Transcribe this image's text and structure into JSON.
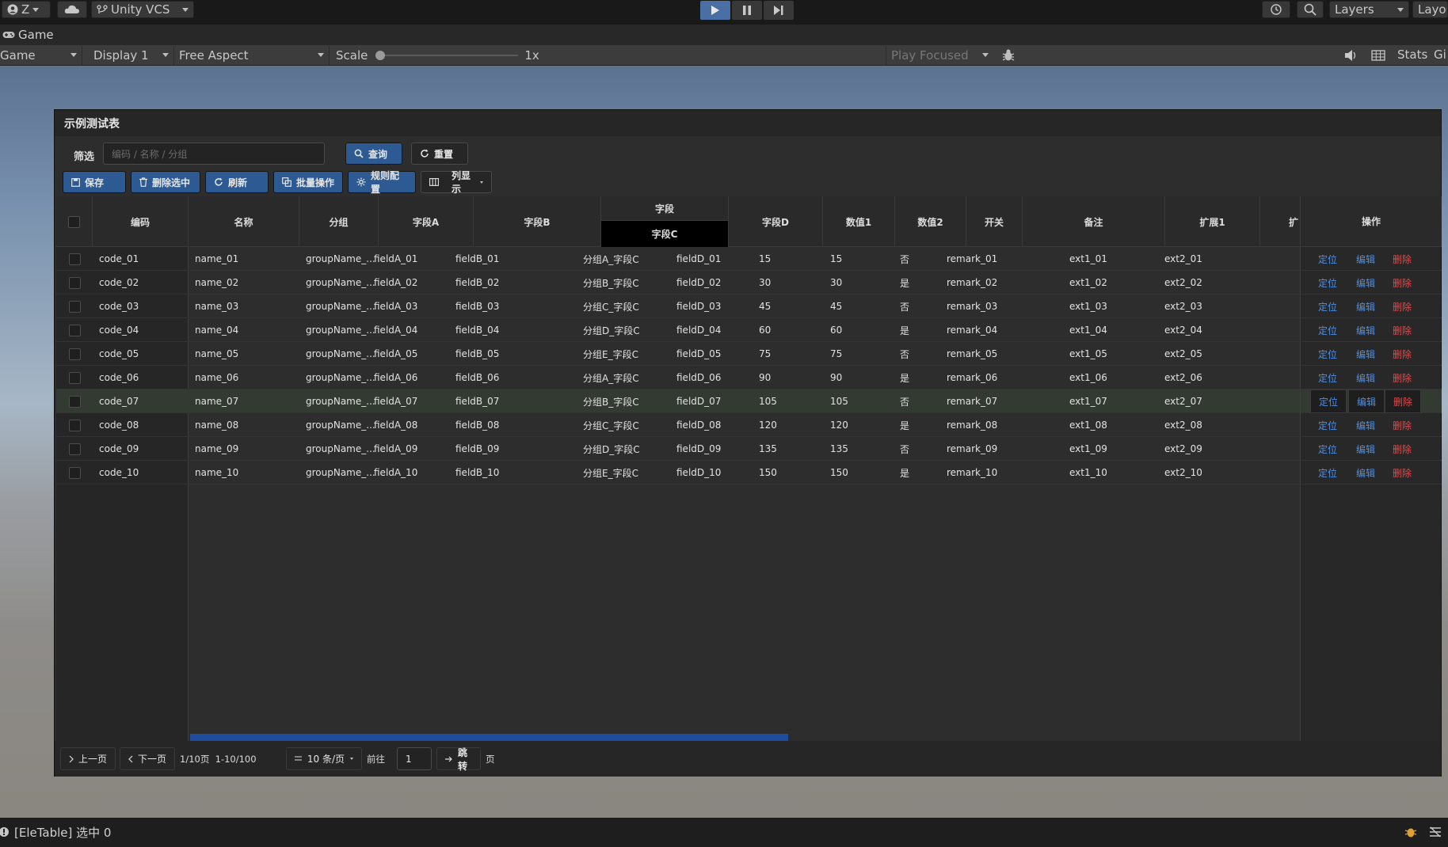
{
  "toolbar": {
    "account": "Z",
    "vcs": "Unity VCS",
    "layers": "Layers",
    "layout": "Layout"
  },
  "game": {
    "tab": "Game",
    "view_dd": "Game",
    "display": "Display 1",
    "aspect": "Free Aspect",
    "scale_label": "Scale",
    "scale_value": "1x",
    "play_focused": "Play Focused",
    "stats": "Stats",
    "gizmos": "Gi"
  },
  "panel": {
    "title": "示例测试表",
    "filter_label": "筛选",
    "search_placeholder": "编码 / 名称 / 分组",
    "query": "查询",
    "reset": "重置",
    "actions": {
      "save": "保存",
      "delete_selected": "删除选中",
      "refresh": "刷新",
      "batch": "批量操作",
      "rules": "规则配置",
      "columns": "列显示"
    }
  },
  "columns": {
    "code": "编码",
    "name": "名称",
    "group": "分组",
    "fieldA": "字段A",
    "fieldB": "字段B",
    "field_group": "字段",
    "fieldC": "字段C",
    "fieldD": "字段D",
    "num1": "数值1",
    "num2": "数值2",
    "toggle": "开关",
    "remark": "备注",
    "ext1": "扩展1",
    "ext2": "扩",
    "ops": "操作"
  },
  "ops": {
    "locate": "定位",
    "edit": "编辑",
    "delete": "删除"
  },
  "rows": [
    {
      "code": "code_01",
      "name": "name_01",
      "group": "groupName_...",
      "a": "fieldA_01",
      "b": "fieldB_01",
      "c": "分组A_字段C",
      "d": "fieldD_01",
      "n1": "15",
      "n2": "15",
      "sw": "否",
      "remark": "remark_01",
      "e1": "ext1_01",
      "e2": "ext2_01"
    },
    {
      "code": "code_02",
      "name": "name_02",
      "group": "groupName_...",
      "a": "fieldA_02",
      "b": "fieldB_02",
      "c": "分组B_字段C",
      "d": "fieldD_02",
      "n1": "30",
      "n2": "30",
      "sw": "是",
      "remark": "remark_02",
      "e1": "ext1_02",
      "e2": "ext2_02"
    },
    {
      "code": "code_03",
      "name": "name_03",
      "group": "groupName_...",
      "a": "fieldA_03",
      "b": "fieldB_03",
      "c": "分组C_字段C",
      "d": "fieldD_03",
      "n1": "45",
      "n2": "45",
      "sw": "否",
      "remark": "remark_03",
      "e1": "ext1_03",
      "e2": "ext2_03"
    },
    {
      "code": "code_04",
      "name": "name_04",
      "group": "groupName_...",
      "a": "fieldA_04",
      "b": "fieldB_04",
      "c": "分组D_字段C",
      "d": "fieldD_04",
      "n1": "60",
      "n2": "60",
      "sw": "是",
      "remark": "remark_04",
      "e1": "ext1_04",
      "e2": "ext2_04"
    },
    {
      "code": "code_05",
      "name": "name_05",
      "group": "groupName_...",
      "a": "fieldA_05",
      "b": "fieldB_05",
      "c": "分组E_字段C",
      "d": "fieldD_05",
      "n1": "75",
      "n2": "75",
      "sw": "否",
      "remark": "remark_05",
      "e1": "ext1_05",
      "e2": "ext2_05"
    },
    {
      "code": "code_06",
      "name": "name_06",
      "group": "groupName_...",
      "a": "fieldA_06",
      "b": "fieldB_06",
      "c": "分组A_字段C",
      "d": "fieldD_06",
      "n1": "90",
      "n2": "90",
      "sw": "是",
      "remark": "remark_06",
      "e1": "ext1_06",
      "e2": "ext2_06"
    },
    {
      "code": "code_07",
      "name": "name_07",
      "group": "groupName_...",
      "a": "fieldA_07",
      "b": "fieldB_07",
      "c": "分组B_字段C",
      "d": "fieldD_07",
      "n1": "105",
      "n2": "105",
      "sw": "否",
      "remark": "remark_07",
      "e1": "ext1_07",
      "e2": "ext2_07"
    },
    {
      "code": "code_08",
      "name": "name_08",
      "group": "groupName_...",
      "a": "fieldA_08",
      "b": "fieldB_08",
      "c": "分组C_字段C",
      "d": "fieldD_08",
      "n1": "120",
      "n2": "120",
      "sw": "是",
      "remark": "remark_08",
      "e1": "ext1_08",
      "e2": "ext2_08"
    },
    {
      "code": "code_09",
      "name": "name_09",
      "group": "groupName_...",
      "a": "fieldA_09",
      "b": "fieldB_09",
      "c": "分组D_字段C",
      "d": "fieldD_09",
      "n1": "135",
      "n2": "135",
      "sw": "否",
      "remark": "remark_09",
      "e1": "ext1_09",
      "e2": "ext2_09"
    },
    {
      "code": "code_10",
      "name": "name_10",
      "group": "groupName_...",
      "a": "fieldA_10",
      "b": "fieldB_10",
      "c": "分组E_字段C",
      "d": "fieldD_10",
      "n1": "150",
      "n2": "150",
      "sw": "是",
      "remark": "remark_10",
      "e1": "ext1_10",
      "e2": "ext2_10"
    }
  ],
  "pager": {
    "prev": "上一页",
    "next": "下一页",
    "info": "1/10页  1-10/100",
    "page_size": "10 条/页",
    "goto_label": "前往",
    "goto_value": "1",
    "jump": "跳转",
    "page_suffix": "页"
  },
  "status": {
    "message": "[EleTable] 选中 0"
  },
  "colors": {
    "accent": "#2d5a92",
    "link": "#4f8fe3",
    "danger": "#e04b4b"
  }
}
